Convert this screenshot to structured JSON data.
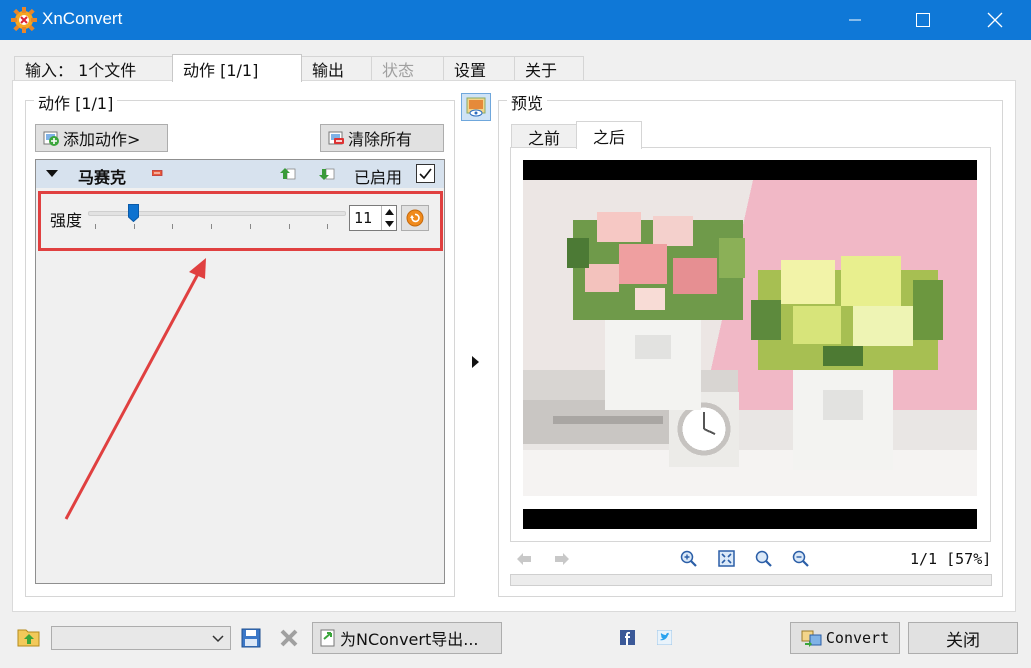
{
  "window": {
    "title": "XnConvert"
  },
  "tabs": [
    {
      "label": "输入： 1个文件",
      "state": "normal"
    },
    {
      "label": "动作 [1/1]",
      "state": "active"
    },
    {
      "label": "输出",
      "state": "normal"
    },
    {
      "label": "状态",
      "state": "disabled"
    },
    {
      "label": "设置",
      "state": "normal"
    },
    {
      "label": "关于",
      "state": "normal"
    }
  ],
  "actions_panel": {
    "title": "动作 [1/1]",
    "add_button": "添加动作>",
    "clear_button": "清除所有",
    "action": {
      "name": "马赛克",
      "enabled_label": "已启用",
      "enabled": true,
      "param_label": "强度",
      "param_value": "11",
      "slider_fraction": 0.16
    }
  },
  "preview_panel": {
    "title": "预览",
    "tabs": [
      "之前",
      "之后"
    ],
    "active_tab": "之后",
    "page_zoom": "1/1 [57%]"
  },
  "bottom": {
    "export_button": "为NConvert导出...",
    "convert_button": "Convert",
    "close_button": "关闭"
  },
  "colors": {
    "titlebar": "#0f78d7",
    "highlight": "#e04040",
    "action_header": "#d7e2ee"
  },
  "icons": [
    "app-logo-icon",
    "minimize-icon",
    "maximize-icon",
    "close-icon",
    "add-action-icon",
    "clear-all-icon",
    "collapse-arrow-icon",
    "remove-action-icon",
    "move-up-icon",
    "move-down-icon",
    "reset-icon",
    "preview-toggle-icon",
    "expand-arrow-icon",
    "prev-icon",
    "next-icon",
    "zoom-in-icon",
    "fit-icon",
    "zoom-actual-icon",
    "zoom-out-icon",
    "open-folder-icon",
    "save-icon",
    "delete-icon",
    "export-icon",
    "facebook-icon",
    "twitter-icon",
    "convert-icon"
  ]
}
